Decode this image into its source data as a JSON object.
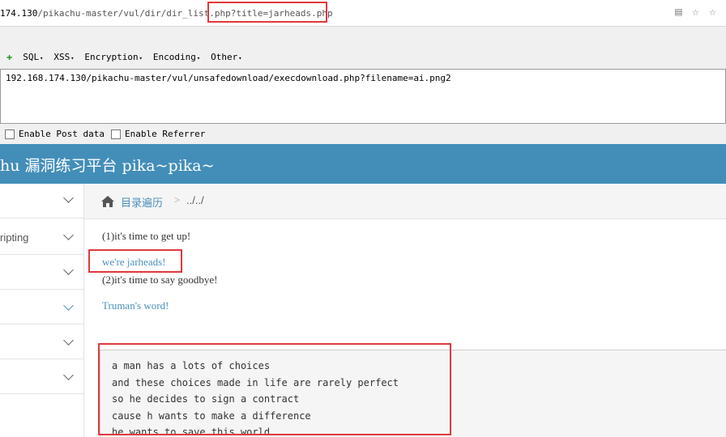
{
  "address_bar": {
    "host": "174.130",
    "path": "/pikachu-master/vul/dir/dir_list.php?title=jarheads.php",
    "icons": [
      "page-icon",
      "star-icon",
      "star-icon"
    ]
  },
  "hackbar": {
    "menu": [
      "SQL",
      "XSS",
      "Encryption",
      "Encoding",
      "Other"
    ],
    "url_value": "192.168.174.130/pikachu-master/vul/unsafedownload/execdownload.php?filename=ai.png2",
    "enable_post_data": "Enable Post data",
    "enable_referrer": "Enable Referrer"
  },
  "site": {
    "title": "hu 漏洞练习平台 pika~pika~"
  },
  "sidebar": {
    "items": [
      {
        "label": ""
      },
      {
        "label": "ripting"
      },
      {
        "label": ""
      },
      {
        "label": ""
      },
      {
        "label": ""
      },
      {
        "label": ""
      }
    ]
  },
  "breadcrumb": {
    "link": "目录遍历",
    "separator": ">",
    "current": "../../"
  },
  "content": {
    "line1": "(1)it's time to get up!",
    "link1": "we're jarheads!",
    "line2": "(2)it's time to say goodbye!",
    "link2": "Truman's word!",
    "poem": [
      "a man has a lots of choices",
      "and these choices made in life are rarely perfect",
      "so he decides to sign a contract",
      "cause h wants to make a difference",
      "he wants to save this world"
    ]
  },
  "colors": {
    "header_bg": "#438eb9",
    "link": "#4c8fbd",
    "highlight_box": "#e0393e"
  }
}
